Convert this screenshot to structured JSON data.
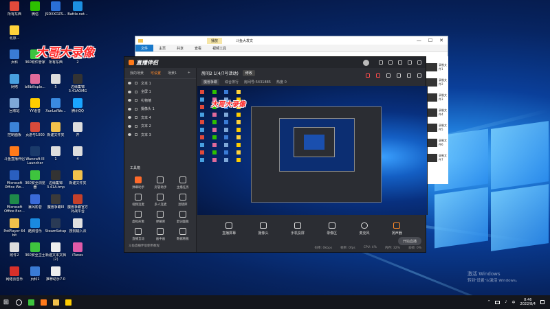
{
  "desktop": {
    "icons": [
      {
        "label": "所有东西",
        "color": "#e04a3b"
      },
      {
        "label": "微信",
        "color": "#2dc100"
      },
      {
        "label": "JSDXXDZS...",
        "color": "#2a6fd6"
      },
      {
        "label": "Battle.net...",
        "color": "#1c8fe0"
      },
      {
        "label": "北京...",
        "color": "#ffd23a"
      },
      {
        "label": "页科",
        "color": "#3a7bd5"
      },
      {
        "label": "360软件管家",
        "color": "#3ec43e"
      },
      {
        "label": "所有东西",
        "color": "#e04a3b"
      },
      {
        "label": "2",
        "color": "#cccccc"
      },
      {
        "label": "网络",
        "color": "#48a0e0"
      },
      {
        "label": "bilibilisplo...",
        "color": "#e06a9a"
      },
      {
        "label": "5",
        "color": "#dddddd"
      },
      {
        "label": "边缘集锦 3.41AOMG",
        "color": "#333333"
      },
      {
        "label": "回收站",
        "color": "#7fa8d8"
      },
      {
        "label": "YY语音",
        "color": "#ffcc00"
      },
      {
        "label": "XunLeiWe...",
        "color": "#3a8ae0"
      },
      {
        "label": "腾讯QQ",
        "color": "#1aa5ff"
      },
      {
        "label": "控制面板",
        "color": "#3b83d8"
      },
      {
        "label": "页游号1000",
        "color": "#d84a3b"
      },
      {
        "label": "新建文件夹",
        "color": "#f2c14b"
      },
      {
        "label": "开",
        "color": "#dddddd"
      },
      {
        "label": "斗鱼直播伴侣",
        "color": "#ff7a1a"
      },
      {
        "label": "Warcraft III Launcher",
        "color": "#1a3a6a"
      },
      {
        "label": "1",
        "color": "#dddddd"
      },
      {
        "label": "4",
        "color": "#dddddd"
      },
      {
        "label": "Microsoft Office Wo...",
        "color": "#2a5fbf"
      },
      {
        "label": "360安全浏览器",
        "color": "#3ec43e"
      },
      {
        "label": "边缘集锦 3.41A.tmp",
        "color": "#333333"
      },
      {
        "label": "新建文件夹",
        "color": "#f2c14b"
      },
      {
        "label": "Microsoft Office Exc...",
        "color": "#1e8a4a"
      },
      {
        "label": "暴风影音",
        "color": "#3a6ad8"
      },
      {
        "label": "魔兽争霸III",
        "color": "#3a3a3a"
      },
      {
        "label": "魔兽争霸官方对战平台",
        "color": "#c4402a"
      },
      {
        "label": "PotPlayer 64 bit",
        "color": "#f2c14b"
      },
      {
        "label": "酷狗音乐",
        "color": "#1a8ae0"
      },
      {
        "label": "SteamSetup",
        "color": "#2a3a55"
      },
      {
        "label": "搜狗输入法",
        "color": "#e0e0e0"
      },
      {
        "label": "附件2",
        "color": "#dddddd"
      },
      {
        "label": "360安全卫士",
        "color": "#3ec43e"
      },
      {
        "label": "新建文本文档 (2)",
        "color": "#eeeeee"
      },
      {
        "label": "iTunes",
        "color": "#e05aa8"
      },
      {
        "label": "网络云音乐",
        "color": "#d8302a"
      },
      {
        "label": "页科1",
        "color": "#3a7bd5"
      },
      {
        "label": "推荐助手7.0",
        "color": "#eeeeee"
      }
    ]
  },
  "overlay_logo": "大哥大录像",
  "explorer": {
    "title": "斗鱼大发文",
    "ribbon": [
      "文件",
      "主页",
      "共享",
      "查看",
      "视频工具"
    ],
    "manage": "播放",
    "controls": [
      "—",
      "☐",
      "✕"
    ]
  },
  "right_strip": {
    "items": [
      "录制文件1",
      "录制文件2",
      "录制文件3",
      "录制文件4",
      "录制文件5",
      "录制文件6",
      "录制文件7"
    ]
  },
  "app": {
    "brand": "直播伴侣",
    "scene_tabs": [
      "我的场景",
      "可设置",
      "场景1",
      "+"
    ],
    "scenes": [
      "文本 1",
      "全屏 1",
      "礼物墙",
      "摄像头 1",
      "文本 4",
      "文本 2",
      "文本 3"
    ],
    "tools_title": "工具箱",
    "tools": [
      "弹幕助手",
      "房管助手",
      "主播任务",
      "视频连麦",
      "多人连麦",
      "滤镜库",
      "虚拟形象",
      "弹幕库",
      "歌词面板",
      "直播互动",
      "画中画",
      "数据看板"
    ],
    "tools_footer": "斗鱼直播伴侣使用教程",
    "room_title": "房间2 1(4/7号活动)",
    "room_badge": "修改",
    "room_category": "魔兽争霸",
    "room_stats": [
      "综合排行",
      "房间号:5431885",
      "热度 0"
    ],
    "controls": [
      "直播屏幕",
      "摄像头",
      "手机投屏",
      "录像区",
      "麦克风",
      "扬声器"
    ],
    "go_live": "开始直播",
    "status": [
      "码率: 0kbps",
      "帧率: 0fps",
      "CPU: 4%",
      "内存: 32%",
      "丢帧: 0%"
    ]
  },
  "taskbar": {
    "start": "⊞",
    "apps": [
      {
        "name": "cortana",
        "color": "#ffffff"
      },
      {
        "name": "360",
        "color": "#3ec43e"
      },
      {
        "name": "douyu",
        "color": "#ff7a1a"
      },
      {
        "name": "explorer",
        "color": "#f2c14b"
      },
      {
        "name": "live-companion",
        "color": "#ffcc00"
      }
    ],
    "time": "8:46",
    "date": "2022/8/4",
    "lang": "中"
  },
  "watermark": {
    "line1": "激活 Windows",
    "line2": "转到\"设置\"以激活 Windows。"
  }
}
